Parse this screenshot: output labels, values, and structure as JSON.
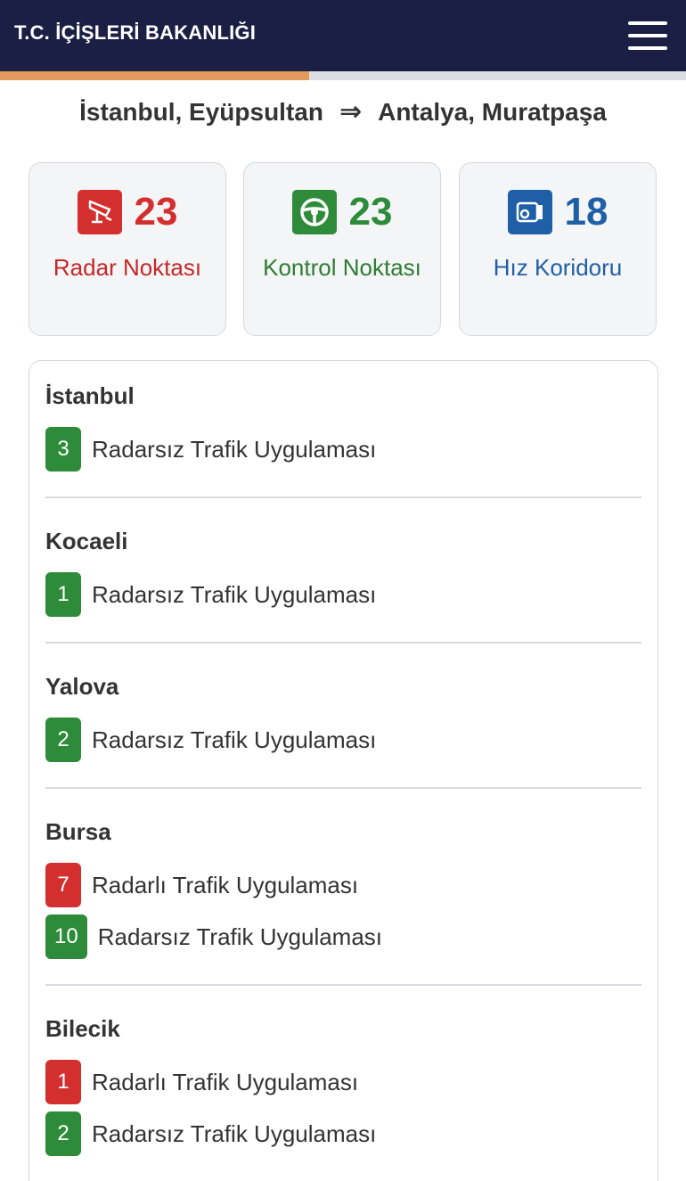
{
  "header": {
    "title": "T.C. İÇİŞLERİ BAKANLIĞI",
    "menu_icon": "hamburger-menu-icon"
  },
  "progress": {
    "fraction": 0.45,
    "fill_color": "#e09a5c"
  },
  "route": {
    "origin": "İstanbul, Eyüpsultan",
    "arrow": "⇒",
    "destination": "Antalya, Muratpaşa"
  },
  "summary": [
    {
      "count": "23",
      "label": "Radar Noktası",
      "icon": "radar-camera-icon",
      "color": "#d32f2f"
    },
    {
      "count": "23",
      "label": "Kontrol Noktası",
      "icon": "steering-wheel-icon",
      "color": "#2e8b3a"
    },
    {
      "count": "18",
      "label": "Hız Koridoru",
      "icon": "speed-camera-icon",
      "color": "#1f5fa8"
    }
  ],
  "cities": [
    {
      "name": "İstanbul",
      "items": [
        {
          "count": "3",
          "type": "green",
          "label": "Radarsız Trafik Uygulaması"
        }
      ]
    },
    {
      "name": "Kocaeli",
      "items": [
        {
          "count": "1",
          "type": "green",
          "label": "Radarsız Trafik Uygulaması"
        }
      ]
    },
    {
      "name": "Yalova",
      "items": [
        {
          "count": "2",
          "type": "green",
          "label": "Radarsız Trafik Uygulaması"
        }
      ]
    },
    {
      "name": "Bursa",
      "items": [
        {
          "count": "7",
          "type": "red",
          "label": "Radarlı Trafik Uygulaması"
        },
        {
          "count": "10",
          "type": "green",
          "label": "Radarsız Trafik Uygulaması"
        }
      ]
    },
    {
      "name": "Bilecik",
      "items": [
        {
          "count": "1",
          "type": "red",
          "label": "Radarlı Trafik Uygulaması"
        },
        {
          "count": "2",
          "type": "green",
          "label": "Radarsız Trafik Uygulaması"
        }
      ]
    }
  ]
}
